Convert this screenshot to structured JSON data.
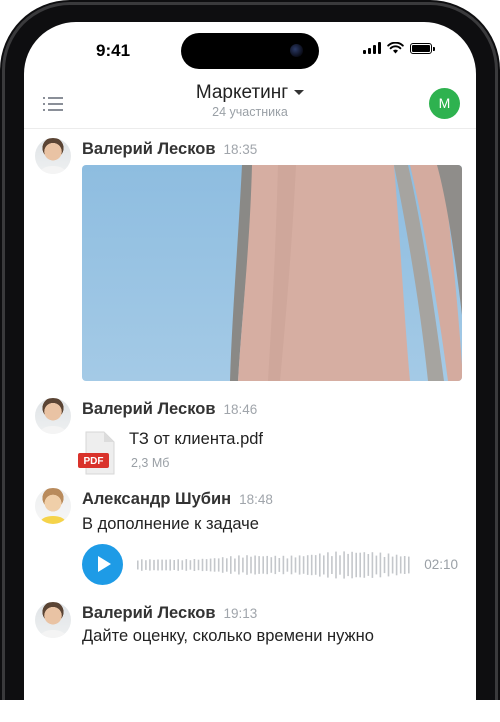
{
  "status_bar": {
    "time": "9:41"
  },
  "header": {
    "title": "Маркетинг",
    "subtitle": "24 участника",
    "user_initial": "М"
  },
  "messages": [
    {
      "author": "Валерий Лесков",
      "time": "18:35",
      "type": "image"
    },
    {
      "author": "Валерий Лесков",
      "time": "18:46",
      "type": "file",
      "file": {
        "badge": "PDF",
        "name": "ТЗ от клиента.pdf",
        "size": "2,3 Мб"
      }
    },
    {
      "author": "Александр Шубин",
      "time": "18:48",
      "type": "voice",
      "text": "В дополнение к задаче",
      "duration": "02:10"
    },
    {
      "author": "Валерий Лесков",
      "time": "19:13",
      "type": "text",
      "text": "Дайте оценку, сколько времени нужно"
    }
  ],
  "icons": {
    "menu": "menu-icon",
    "dropdown": "chevron-down-icon",
    "file": "pdf-file-icon",
    "play": "play-icon"
  },
  "colors": {
    "accent": "#1e9be6",
    "avatar_green": "#2eb24f",
    "pdf_red": "#d9322b"
  }
}
